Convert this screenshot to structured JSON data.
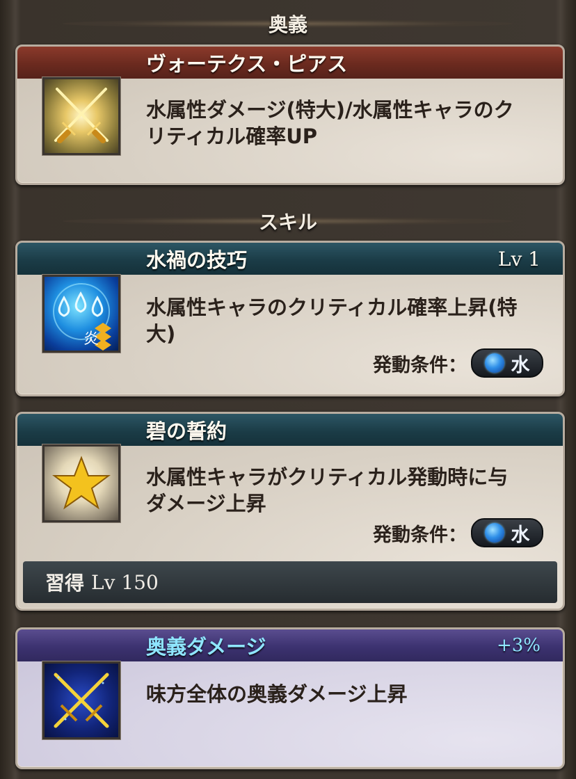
{
  "sections": {
    "ougi_header": "奥義",
    "skill_header": "スキル"
  },
  "ougi": {
    "name": "ヴォーテクス・ピアス",
    "description_line1": "水属性ダメージ(特大)/水属性キャラのク",
    "description_line2": "リティカル確率UP",
    "icon": "crossed-swords-icon"
  },
  "skills": [
    {
      "name": "水禍の技巧",
      "level": "Lv 1",
      "description_line1": "水属性キャラのクリティカル確率上昇(特",
      "description_line2": "大)",
      "condition_label": "発動条件：",
      "condition_value": "水",
      "icon": "water-drops-icon"
    },
    {
      "name": "碧の誓約",
      "description_line1": "水属性キャラがクリティカル発動時に与",
      "description_line2": "ダメージ上昇",
      "condition_label": "発動条件：",
      "condition_value": "水",
      "acquire_label": "習得",
      "acquire_level": "Lv 150",
      "icon": "star-icon"
    }
  ],
  "ougi_damage": {
    "name": "奥義ダメージ",
    "bonus": "+3%",
    "description": "味方全体の奥義ダメージ上昇",
    "icon": "crossed-swords-blue-icon"
  },
  "colors": {
    "ougi_title_bar": "#6b2a1f",
    "skill_title_bar": "#1b3c47",
    "ougi_damage_title_bar": "#3c3270",
    "water_accent": "#2f8fe8",
    "cyan_text": "#8fe6ff"
  }
}
